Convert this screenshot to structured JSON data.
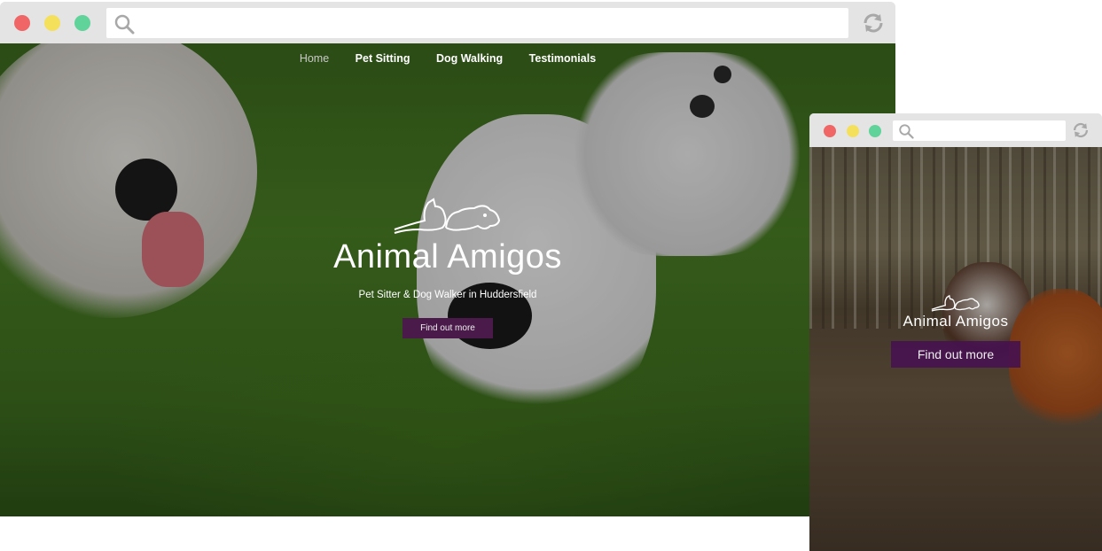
{
  "desktop": {
    "nav": {
      "items": [
        {
          "label": "Home",
          "active": true
        },
        {
          "label": "Pet Sitting",
          "active": false
        },
        {
          "label": "Dog Walking",
          "active": false
        },
        {
          "label": "Testimonials",
          "active": false
        }
      ]
    },
    "hero": {
      "logo_icon": "dog-cat-logo-icon",
      "title": "Animal Amigos",
      "subtitle": "Pet Sitter & Dog Walker in Huddersfield",
      "cta_label": "Find out more"
    }
  },
  "mobile": {
    "hero": {
      "logo_icon": "dog-cat-logo-icon",
      "title": "Animal Amigos",
      "cta_label": "Find out more"
    }
  },
  "chrome": {
    "icons": [
      "search-icon",
      "refresh-icon"
    ],
    "traffic_lights": [
      "#f06565",
      "#f5e05c",
      "#5fd39a"
    ]
  },
  "colors": {
    "cta_background": "#4a1b4a",
    "nav_active": "#c9c9c9",
    "nav_text": "#ffffff"
  }
}
